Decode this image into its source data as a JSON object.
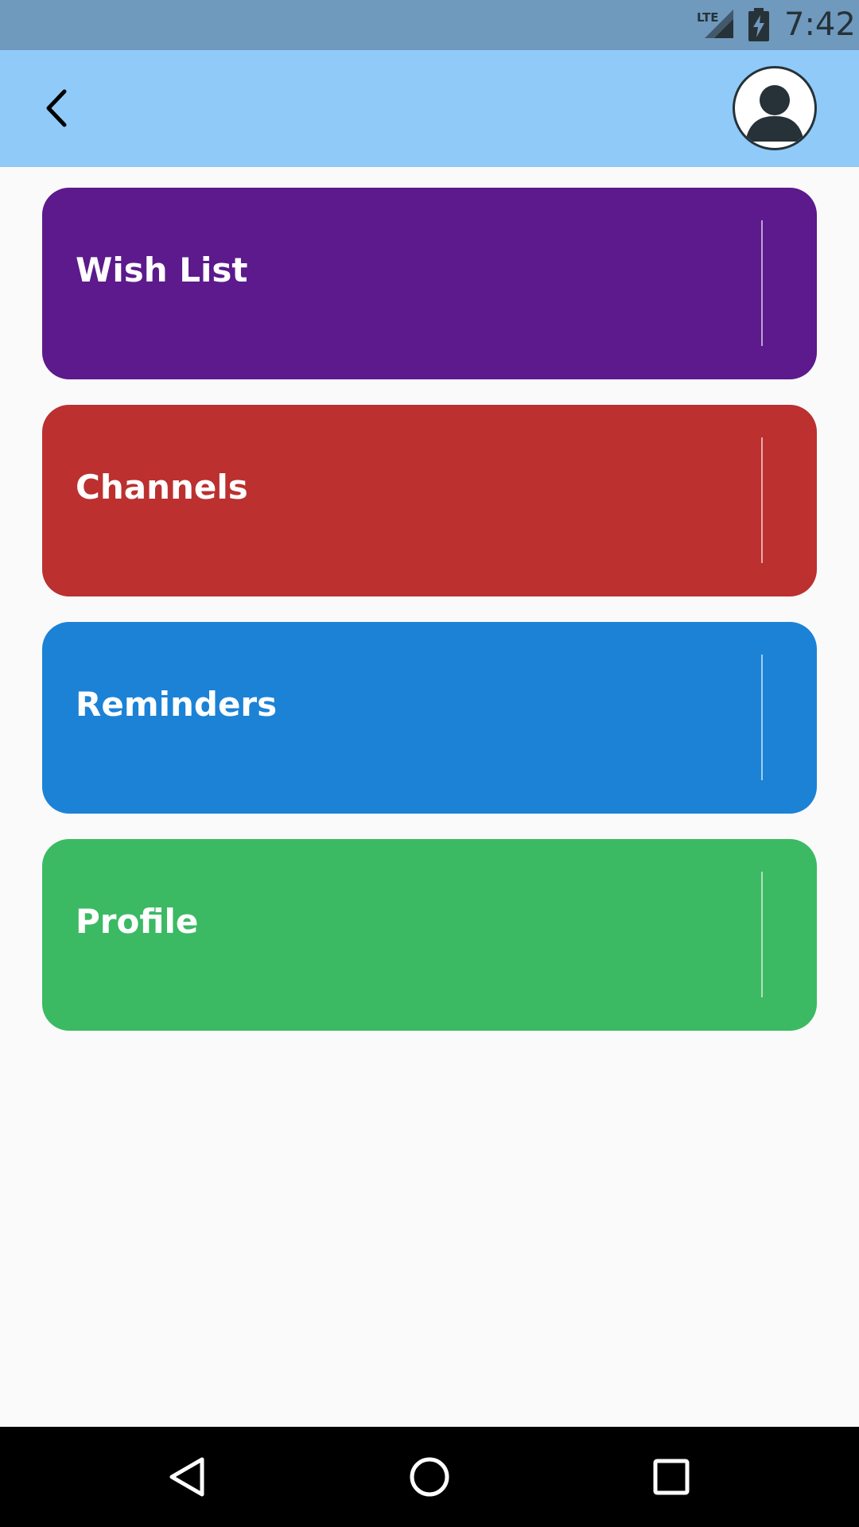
{
  "status_bar": {
    "time": "7:42",
    "network": "LTE",
    "icons": {
      "signal": "lte-signal-icon",
      "battery": "battery-charging-icon"
    },
    "background": "#6f99bd"
  },
  "app_bar": {
    "background": "#90caf9",
    "back_icon": "back-arrow-icon",
    "avatar_icon": "account-avatar-icon"
  },
  "menu": {
    "items": [
      {
        "label": "Wish List",
        "color": "#5c1a8c"
      },
      {
        "label": "Channels",
        "color": "#bc3030"
      },
      {
        "label": "Reminders",
        "color": "#1c82d6"
      },
      {
        "label": "Profile",
        "color": "#3bba63"
      }
    ]
  },
  "nav_bar": {
    "buttons": [
      "back-triangle-icon",
      "home-circle-icon",
      "recents-square-icon"
    ]
  }
}
